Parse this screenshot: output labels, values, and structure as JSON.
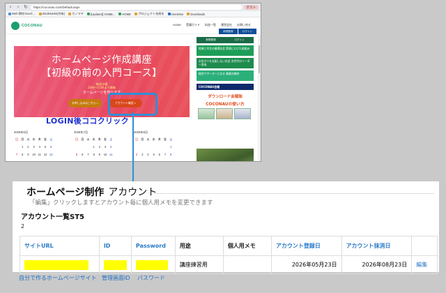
{
  "browser": {
    "url": "https://coconau.com/Default.aspx",
    "profile": "ゲスト",
    "bookmarks": [
      "Web 教材 Excel ...",
      "Bookmarks(共有)",
      "カノマチ",
      "[Updated] HOME...",
      "HOME",
      "プロジェクト名前を",
      "OneDrive",
      "Downloads"
    ]
  },
  "site": {
    "logo": "COCONAU",
    "nav": [
      "HOME",
      "受講ガイド",
      "料金一覧",
      "運営会社",
      "お問い合せ"
    ],
    "head_buttons": [
      "新規登録",
      "ログイン"
    ],
    "banner": {
      "title1": "ホームページ作成講座",
      "title2": "【初級の前の入門コース】",
      "sub1": "毎週水曜",
      "sub2": "20時〜21時まで開催",
      "sub3": "ホームページを作ります",
      "btn_signup": "お申し込みはこちら »",
      "btn_account": "アカウント確認 »"
    },
    "login_annotation": "LOGIN後ココクリック",
    "calendars": [
      {
        "head": "2026年6月",
        "rows": [
          [
            "",
            "1",
            "2",
            "3",
            "4",
            "5",
            "6"
          ],
          [
            "7",
            "8",
            "9",
            "10",
            "11",
            "12",
            "13"
          ],
          [
            "14",
            "15",
            "16",
            "17",
            "18",
            "19",
            "20"
          ]
        ]
      },
      {
        "head": "2026年7月",
        "rows": [
          [
            "",
            "",
            "",
            "1",
            "2",
            "3",
            "4"
          ],
          [
            "5",
            "6",
            "7",
            "8",
            "9",
            "10",
            "11"
          ],
          [
            "12",
            "13",
            "14",
            "15",
            "16",
            "17",
            "18"
          ]
        ]
      },
      {
        "head": "2026年8月",
        "rows": [
          [
            "",
            "",
            "",
            "",
            "",
            "",
            "1"
          ],
          [
            "2",
            "3",
            "4",
            "5",
            "6",
            "7",
            "8"
          ],
          [
            "9",
            "10",
            "11",
            "12",
            "13",
            "14",
            "15"
          ]
        ]
      }
    ],
    "weekdays": [
      "日",
      "月",
      "火",
      "水",
      "木",
      "金",
      "土"
    ],
    "side": {
      "tabs": [
        "新規登録",
        "ログイン"
      ],
      "cards": [
        "地域と共生の循環社会\n実現にむけた取組み",
        "お金が人を支配しない社会\n次世代のリーダー育成",
        "総合サポーターになる\n事業の教材"
      ],
      "header": "COCONAU会報",
      "ad1": "ダウンロード会報誌",
      "ad2": "COCONAUの使い方"
    }
  },
  "page": {
    "title_bold": "ホームページ制作",
    "title_light": "アカウント",
    "desc": "「編集」クリックしますとアカウント毎に個人用メモを変更できます",
    "section": "アカウント一覧ST5",
    "count": "2",
    "columns": [
      "サイトURL",
      "ID",
      "Password",
      "用途",
      "個人用メモ",
      "アカウント登録日",
      "アカウント抹消日",
      ""
    ],
    "row": {
      "usage": "講座練習用",
      "memo": "",
      "registered": "2026年05月23日",
      "deleted": "2026年08月23日",
      "edit": "編集"
    }
  },
  "captions": {
    "site": "自分で作るホームページサイト",
    "id": "管理画面ID",
    "password": "パスワード"
  }
}
